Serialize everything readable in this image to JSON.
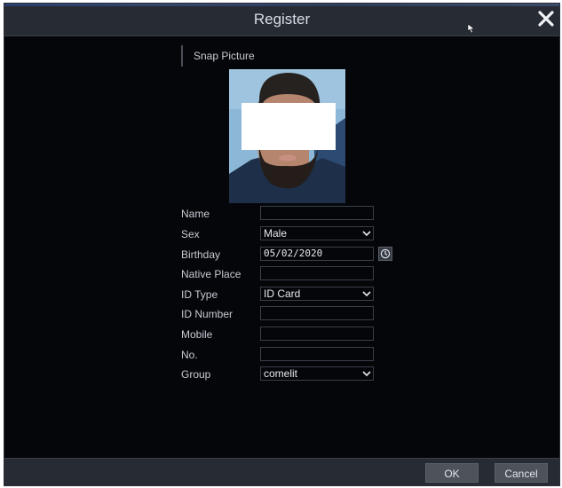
{
  "dialog": {
    "title": "Register",
    "close_icon": "close-icon",
    "cursor_icon": "mouse-cursor-icon"
  },
  "snap": {
    "label": "Snap Picture",
    "photo_icon": "face-snapshot-photo"
  },
  "form": {
    "name": {
      "label": "Name",
      "value": ""
    },
    "sex": {
      "label": "Sex",
      "value": "Male",
      "icon": "chevron-down-icon"
    },
    "birthday": {
      "label": "Birthday",
      "value": "05/02/2020",
      "icon": "clock-icon"
    },
    "native_place": {
      "label": "Native Place",
      "value": ""
    },
    "id_type": {
      "label": "ID Type",
      "value": "ID Card",
      "icon": "chevron-down-icon"
    },
    "id_number": {
      "label": "ID Number",
      "value": ""
    },
    "mobile": {
      "label": "Mobile",
      "value": ""
    },
    "no": {
      "label": "No.",
      "value": ""
    },
    "group": {
      "label": "Group",
      "value": "comelit",
      "icon": "chevron-down-icon"
    }
  },
  "footer": {
    "ok_label": "OK",
    "cancel_label": "Cancel"
  },
  "colors": {
    "background": "#05060a",
    "titlebar": "#272b33",
    "text": "#c6cad2",
    "field_border": "#3a3f49",
    "button": "#4d525b"
  }
}
